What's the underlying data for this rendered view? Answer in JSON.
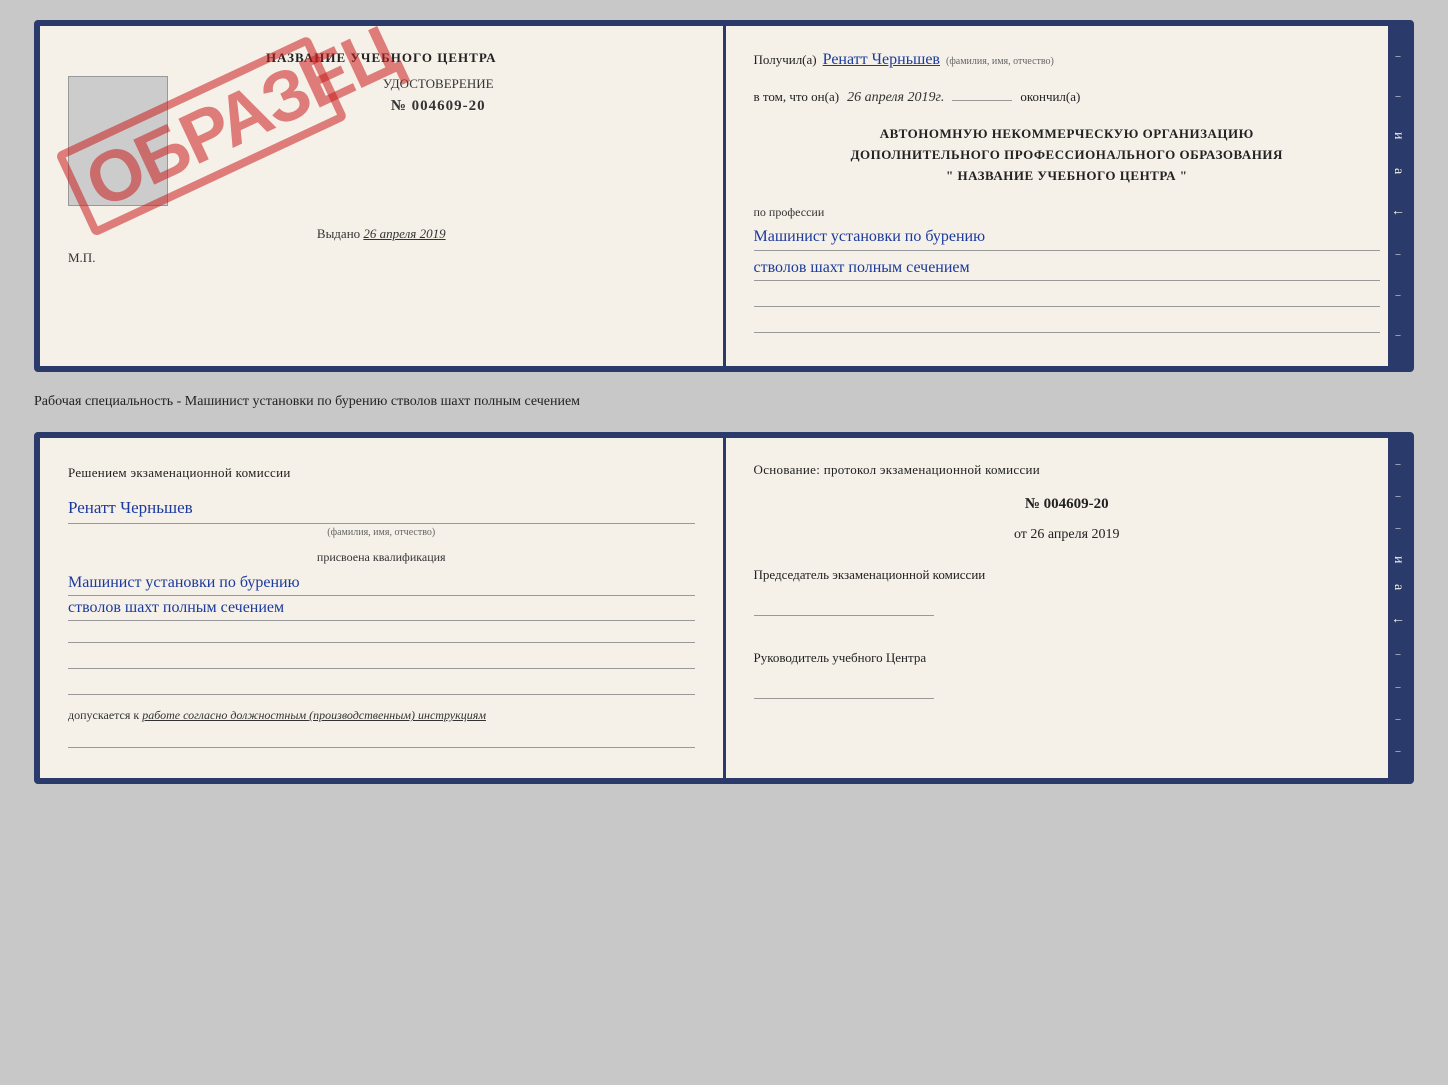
{
  "top_document": {
    "left": {
      "title": "НАЗВАНИЕ УЧЕБНОГО ЦЕНТРА",
      "cert_label": "УДОСТОВЕРЕНИЕ",
      "cert_number": "№ 004609-20",
      "issued_label": "Выдано",
      "issued_date": "26 апреля 2019",
      "mp_label": "М.П.",
      "stamp_text": "ОБРАЗЕЦ"
    },
    "right": {
      "received_prefix": "Получил(а)",
      "received_name": "Ренатт Черньшев",
      "name_hint": "(фамилия, имя, отчество)",
      "date_prefix": "в том, что он(а)",
      "date_value": "26 апреля 2019г.",
      "date_suffix": "окончил(а)",
      "org_line1": "АВТОНОМНУЮ НЕКОММЕРЧЕСКУЮ ОРГАНИЗАЦИЮ",
      "org_line2": "ДОПОЛНИТЕЛЬНОГО ПРОФЕССИОНАЛЬНОГО ОБРАЗОВАНИЯ",
      "org_line3": "\"   НАЗВАНИЕ УЧЕБНОГО ЦЕНТРА   \"",
      "profession_label": "по профессии",
      "profession_line1": "Машинист установки по бурению",
      "profession_line2": "стволов шахт полным сечением"
    }
  },
  "specialty_label": "Рабочая специальность - Машинист установки по бурению стволов шахт полным сечением",
  "bottom_document": {
    "left": {
      "commission_title": "Решением  экзаменационной  комиссии",
      "person_name": "Ренатт Черньшев",
      "name_hint": "(фамилия, имя, отчество)",
      "qualification_prefix": "присвоена квалификация",
      "qualification_line1": "Машинист установки по бурению",
      "qualification_line2": "стволов шахт полным сечением",
      "допускается_prefix": "допускается к",
      "допускается_text": "работе согласно должностным (производственным) инструкциям"
    },
    "right": {
      "osnov_title": "Основание:  протокол  экзаменационной  комиссии",
      "protocol_number": "№  004609-20",
      "protocol_date_prefix": "от",
      "protocol_date": "26 апреля 2019",
      "chairman_label": "Председатель экзаменационной комиссии",
      "director_label": "Руководитель учебного Центра"
    }
  }
}
